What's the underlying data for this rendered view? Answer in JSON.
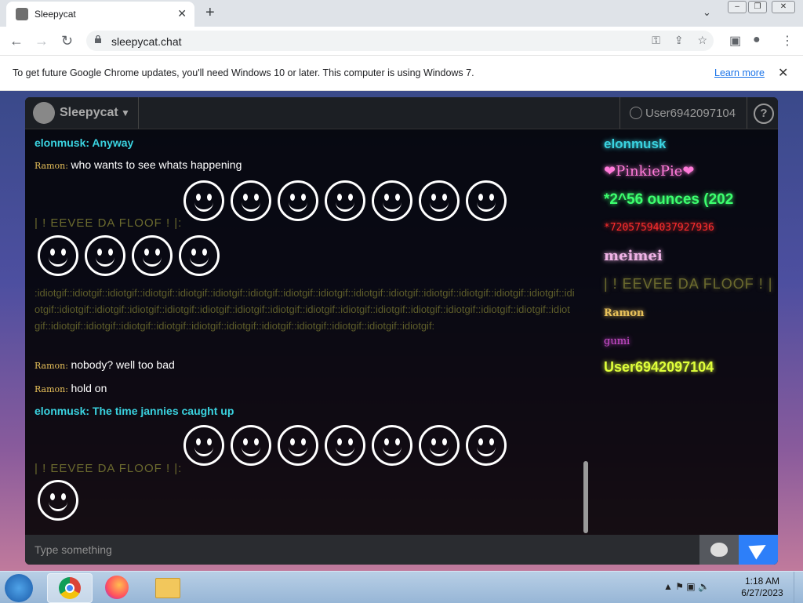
{
  "browser": {
    "tab_title": "Sleepycat",
    "url": "sleepycat.chat",
    "new_tab": "+",
    "tab_close": "✕",
    "nav_back": "←",
    "nav_forward": "→",
    "nav_reload": "↻",
    "omnibox_icons": [
      "key-icon",
      "share-icon",
      "star-icon"
    ],
    "sidebar_icon": "sidebar-icon",
    "profile_icon": "profile-icon",
    "menu_icon": "⋮"
  },
  "infobar": {
    "text": "To get future Google Chrome updates, you'll need Windows 10 or later. This computer is using Windows 7.",
    "link": "Learn more",
    "close": "✕"
  },
  "app": {
    "brand": "Sleepycat",
    "brand_caret": "▼",
    "username": "User6942097104",
    "help": "?"
  },
  "messages": [
    {
      "user": "elonmusk",
      "text": "Anyway",
      "style": "elon"
    },
    {
      "user": "Ramon",
      "text": "who wants to see whats happening",
      "style": "ramon"
    },
    {
      "user": "| ! EEVEE DA FLOOF ! |",
      "text": "",
      "style": "eevee"
    },
    {
      "user": "Ramon",
      "text": "nobody? well too bad",
      "style": "ramon"
    },
    {
      "user": "Ramon",
      "text": "hold on",
      "style": "ramon"
    },
    {
      "user": "elonmusk",
      "text": "The time jannies caught up",
      "style": "elon"
    },
    {
      "user": "| ! EEVEE DA FLOOF ! |",
      "text": "",
      "style": "eevee"
    }
  ],
  "spam_text": ":idiotgif::idiotgif::idiotgif::idiotgif::idiotgif::idiotgif::idiotgif::idiotgif::idiotgif::idiotgif::idiotgif::idiotgif::idiotgif::idiotgif::idiotgif::idiotgif::idiotgif::idiotgif::idiotgif::idiotgif::idiotgif::idiotgif::idiotgif::idiotgif::idiotgif::idiotgif::idiotgif::idiotgif::idiotgif::idiotgif::idiotgif::idiotgif::idiotgif::idiotgif::idiotgif::idiotgif::idiotgif::idiotgif::idiotgif::idiotgif::idiotgif::idiotgif:",
  "userlist": [
    {
      "name": "elonmusk",
      "color": "#3ad3e0"
    },
    {
      "name": "❤PinkiePie❤",
      "color": "#ff7ad9"
    },
    {
      "name": "*2^56 ounces (202",
      "color": "#3cff6e"
    },
    {
      "name": "*72057594037927936",
      "color": "#ff2d2d"
    },
    {
      "name": "meimei",
      "color": "#f0b3e6"
    },
    {
      "name": "| ! EEVEE DA FLOOF ! |",
      "color": "#6b6a2e"
    },
    {
      "name": "Ramon",
      "color": "#e8c15a"
    },
    {
      "name": "gumi",
      "color": "#d44fd6"
    },
    {
      "name": "User6942097104",
      "color": "#dfff3a"
    }
  ],
  "input": {
    "placeholder": "Type something"
  },
  "taskbar": {
    "time": "1:18 AM",
    "date": "6/27/2023",
    "tray_icons": "▲ ⚑ ▣ 🔈"
  }
}
